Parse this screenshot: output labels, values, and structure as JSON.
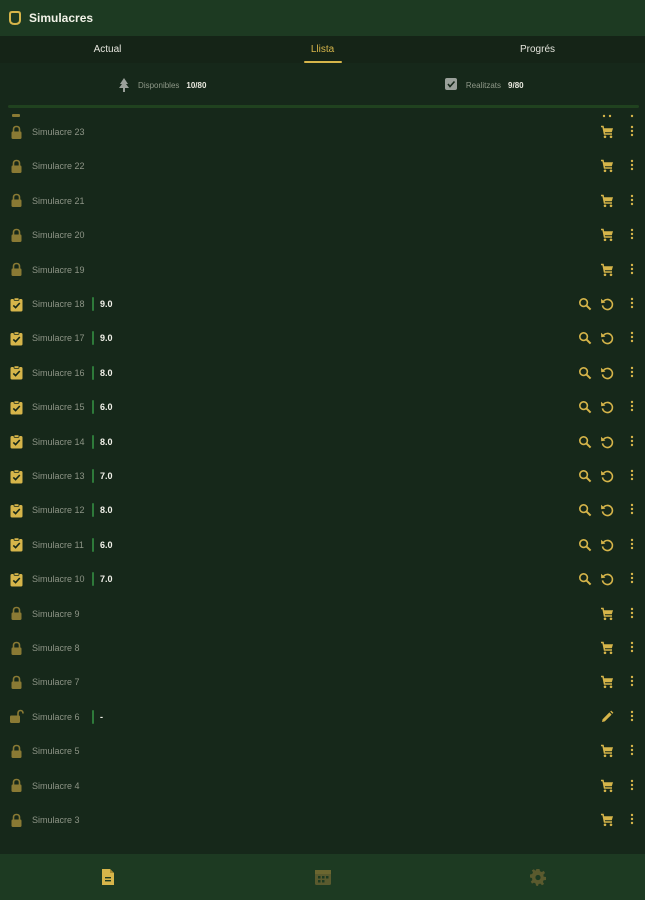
{
  "app": {
    "title": "Simulacres",
    "colors": {
      "accent": "#d6b54a",
      "background": "#16281a",
      "bar": "#1d3a22",
      "separator": "#2e7a3a"
    }
  },
  "tabs": [
    {
      "label": "Actual",
      "active": false
    },
    {
      "label": "Llista",
      "active": true
    },
    {
      "label": "Progrés",
      "active": false
    }
  ],
  "stats": {
    "available": {
      "icon": "tree-icon",
      "label": "Disponibles",
      "value": "10/80"
    },
    "done": {
      "icon": "checkbox-icon",
      "label": "Realitzats",
      "value": "9/80"
    }
  },
  "items": [
    {
      "name": "Simulacre 23",
      "status": "locked",
      "score": null,
      "actions": [
        "cart"
      ]
    },
    {
      "name": "Simulacre 22",
      "status": "locked",
      "score": null,
      "actions": [
        "cart"
      ]
    },
    {
      "name": "Simulacre 21",
      "status": "locked",
      "score": null,
      "actions": [
        "cart"
      ]
    },
    {
      "name": "Simulacre 20",
      "status": "locked",
      "score": null,
      "actions": [
        "cart"
      ]
    },
    {
      "name": "Simulacre 19",
      "status": "locked",
      "score": null,
      "actions": [
        "cart"
      ]
    },
    {
      "name": "Simulacre 18",
      "status": "done",
      "score": "9.0",
      "actions": [
        "search",
        "retry"
      ]
    },
    {
      "name": "Simulacre 17",
      "status": "done",
      "score": "9.0",
      "actions": [
        "search",
        "retry"
      ]
    },
    {
      "name": "Simulacre 16",
      "status": "done",
      "score": "8.0",
      "actions": [
        "search",
        "retry"
      ]
    },
    {
      "name": "Simulacre 15",
      "status": "done",
      "score": "6.0",
      "actions": [
        "search",
        "retry"
      ]
    },
    {
      "name": "Simulacre 14",
      "status": "done",
      "score": "8.0",
      "actions": [
        "search",
        "retry"
      ]
    },
    {
      "name": "Simulacre 13",
      "status": "done",
      "score": "7.0",
      "actions": [
        "search",
        "retry"
      ]
    },
    {
      "name": "Simulacre 12",
      "status": "done",
      "score": "8.0",
      "actions": [
        "search",
        "retry"
      ]
    },
    {
      "name": "Simulacre 11",
      "status": "done",
      "score": "6.0",
      "actions": [
        "search",
        "retry"
      ]
    },
    {
      "name": "Simulacre 10",
      "status": "done",
      "score": "7.0",
      "actions": [
        "search",
        "retry"
      ]
    },
    {
      "name": "Simulacre 9",
      "status": "locked",
      "score": null,
      "actions": [
        "cart"
      ]
    },
    {
      "name": "Simulacre 8",
      "status": "locked",
      "score": null,
      "actions": [
        "cart"
      ]
    },
    {
      "name": "Simulacre 7",
      "status": "locked",
      "score": null,
      "actions": [
        "cart"
      ]
    },
    {
      "name": "Simulacre 6",
      "status": "unlocked",
      "score": "-",
      "actions": [
        "edit"
      ]
    },
    {
      "name": "Simulacre 5",
      "status": "locked",
      "score": null,
      "actions": [
        "cart"
      ]
    },
    {
      "name": "Simulacre 4",
      "status": "locked",
      "score": null,
      "actions": [
        "cart"
      ]
    },
    {
      "name": "Simulacre 3",
      "status": "locked",
      "score": null,
      "actions": [
        "cart"
      ]
    }
  ],
  "bottom_nav": [
    {
      "icon": "document-icon",
      "active": true
    },
    {
      "icon": "calendar-icon",
      "active": false
    },
    {
      "icon": "gear-icon",
      "active": false
    }
  ]
}
